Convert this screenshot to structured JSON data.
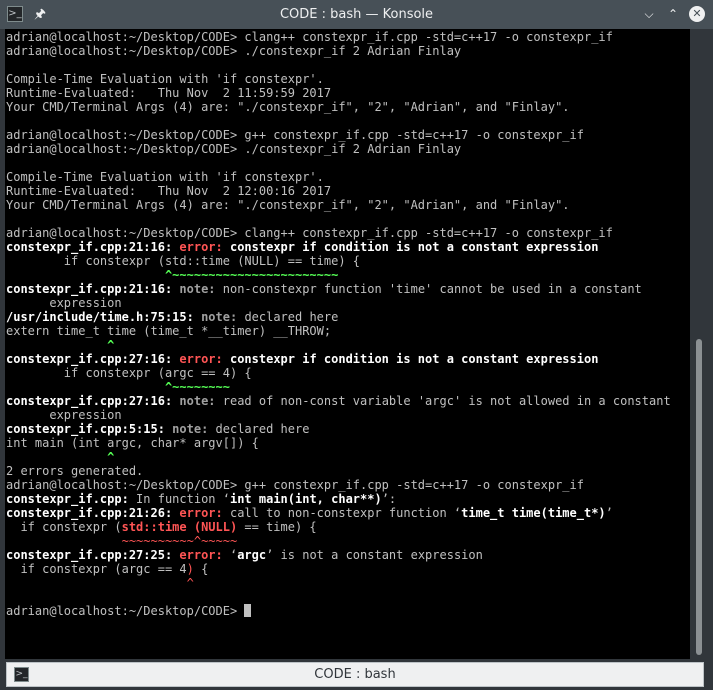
{
  "window": {
    "title": "CODE : bash — Konsole",
    "app_icon": "terminal-icon",
    "pin_icon": "pin-icon",
    "buttons": {
      "minimize": "⌵",
      "maximize": "⌃",
      "close": "✕"
    }
  },
  "terminal": {
    "lines": [
      [
        {
          "t": "adrian@localhost:~/Desktop/CODE> clang++ constexpr_if.cpp -std=c++17 -o constexpr_if"
        }
      ],
      [
        {
          "t": "adrian@localhost:~/Desktop/CODE> ./constexpr_if 2 Adrian Finlay"
        }
      ],
      [
        {
          "t": ""
        }
      ],
      [
        {
          "t": "Compile-Time Evaluation with 'if constexpr'."
        }
      ],
      [
        {
          "t": "Runtime-Evaluated:   Thu Nov  2 11:59:59 2017"
        }
      ],
      [
        {
          "t": "Your CMD/Terminal Args (4) are: \"./constexpr_if\", \"2\", \"Adrian\", and \"Finlay\"."
        }
      ],
      [
        {
          "t": ""
        }
      ],
      [
        {
          "t": "adrian@localhost:~/Desktop/CODE> g++ constexpr_if.cpp -std=c++17 -o constexpr_if"
        }
      ],
      [
        {
          "t": "adrian@localhost:~/Desktop/CODE> ./constexpr_if 2 Adrian Finlay"
        }
      ],
      [
        {
          "t": ""
        }
      ],
      [
        {
          "t": "Compile-Time Evaluation with 'if constexpr'."
        }
      ],
      [
        {
          "t": "Runtime-Evaluated:   Thu Nov  2 12:00:16 2017"
        }
      ],
      [
        {
          "t": "Your CMD/Terminal Args (4) are: \"./constexpr_if\", \"2\", \"Adrian\", and \"Finlay\"."
        }
      ],
      [
        {
          "t": ""
        }
      ],
      [
        {
          "t": "adrian@localhost:~/Desktop/CODE> clang++ constexpr_if.cpp -std=c++17 -o constexpr_if"
        }
      ],
      [
        {
          "t": "constexpr_if.cpp:21:16: ",
          "s": "bold"
        },
        {
          "t": "error: ",
          "s": "err"
        },
        {
          "t": "constexpr if condition is not a constant expression",
          "s": "bold"
        }
      ],
      [
        {
          "t": "        if constexpr (std::time (NULL) == time) {"
        }
      ],
      [
        {
          "t": "                      ^~~~~~~~~~~~~~~~~~~~~~~~",
          "s": "green"
        }
      ],
      [
        {
          "t": "constexpr_if.cpp:21:16: ",
          "s": "bold"
        },
        {
          "t": "note: ",
          "s": "note"
        },
        {
          "t": "non-constexpr function 'time' cannot be used in a constant"
        }
      ],
      [
        {
          "t": "      expression"
        }
      ],
      [
        {
          "t": "/usr/include/time.h:75:15: ",
          "s": "bold"
        },
        {
          "t": "note: ",
          "s": "note"
        },
        {
          "t": "declared here"
        }
      ],
      [
        {
          "t": "extern time_t time (time_t *__timer) __THROW;"
        }
      ],
      [
        {
          "t": "              ^",
          "s": "green"
        }
      ],
      [
        {
          "t": "constexpr_if.cpp:27:16: ",
          "s": "bold"
        },
        {
          "t": "error: ",
          "s": "err"
        },
        {
          "t": "constexpr if condition is not a constant expression",
          "s": "bold"
        }
      ],
      [
        {
          "t": "        if constexpr (argc == 4) {"
        }
      ],
      [
        {
          "t": "                      ^~~~~~~~~",
          "s": "green"
        }
      ],
      [
        {
          "t": "constexpr_if.cpp:27:16: ",
          "s": "bold"
        },
        {
          "t": "note: ",
          "s": "note"
        },
        {
          "t": "read of non-const variable 'argc' is not allowed in a constant"
        }
      ],
      [
        {
          "t": "      expression"
        }
      ],
      [
        {
          "t": "constexpr_if.cpp:5:15: ",
          "s": "bold"
        },
        {
          "t": "note: ",
          "s": "note"
        },
        {
          "t": "declared here"
        }
      ],
      [
        {
          "t": "int main (int argc, char* argv[]) {"
        }
      ],
      [
        {
          "t": "              ^",
          "s": "green"
        }
      ],
      [
        {
          "t": "2 errors generated."
        }
      ],
      [
        {
          "t": "adrian@localhost:~/Desktop/CODE> g++ constexpr_if.cpp -std=c++17 -o constexpr_if"
        }
      ],
      [
        {
          "t": "constexpr_if.cpp:",
          "s": "bold"
        },
        {
          "t": " In function ‘"
        },
        {
          "t": "int main(int, char**)",
          "s": "bold"
        },
        {
          "t": "’:"
        }
      ],
      [
        {
          "t": "constexpr_if.cpp:21:26: ",
          "s": "bold"
        },
        {
          "t": "error: ",
          "s": "err"
        },
        {
          "t": "call to non-constexpr function ‘"
        },
        {
          "t": "time_t time(time_t*)",
          "s": "bold"
        },
        {
          "t": "’"
        }
      ],
      [
        {
          "t": "  if constexpr ("
        },
        {
          "t": "std::time (NULL)",
          "s": "errbold"
        },
        {
          "t": " == time) {"
        }
      ],
      [
        {
          "t": "                ~~~~~~~~~~^~~~~~",
          "s": "red"
        }
      ],
      [
        {
          "t": "constexpr_if.cpp:27:25: ",
          "s": "bold"
        },
        {
          "t": "error: ",
          "s": "err"
        },
        {
          "t": "‘"
        },
        {
          "t": "argc",
          "s": "bold"
        },
        {
          "t": "’ is not a constant expression"
        }
      ],
      [
        {
          "t": "  if constexpr (argc == 4"
        },
        {
          "t": ")",
          "s": "errtxt"
        },
        {
          "t": " {"
        }
      ],
      [
        {
          "t": "                         ^",
          "s": "red"
        }
      ],
      [
        {
          "t": ""
        }
      ],
      [
        {
          "t": "adrian@localhost:~/Desktop/CODE> "
        },
        {
          "t": "",
          "s": "cursor"
        }
      ]
    ]
  },
  "tabs": [
    {
      "label": "CODE : bash",
      "icon": "terminal-icon"
    }
  ]
}
